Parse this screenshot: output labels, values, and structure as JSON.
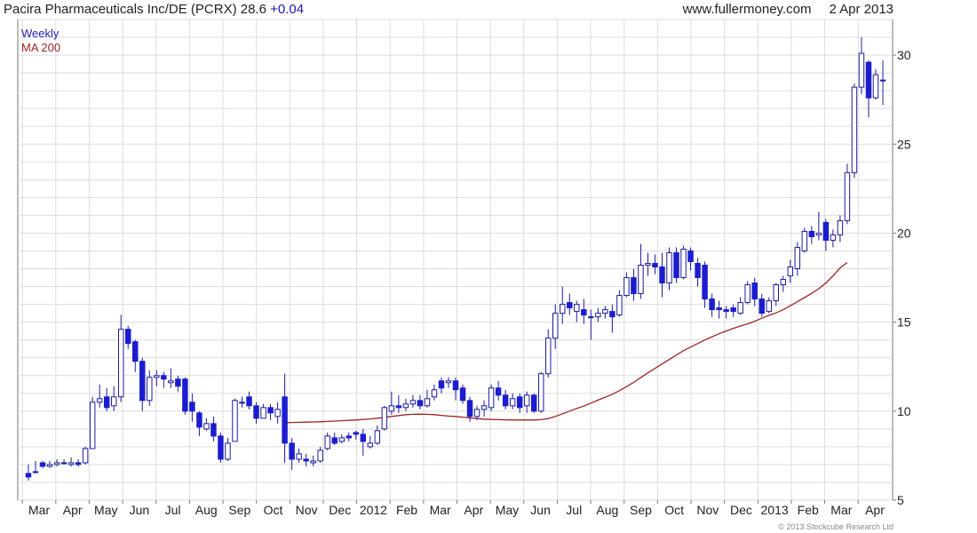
{
  "header": {
    "title": "Pacira Pharmaceuticals Inc/DE (PCRX) 28.6",
    "change": "+0.04",
    "site": "www.fullermoney.com",
    "date": "2 Apr 2013"
  },
  "legend": {
    "weekly": "Weekly",
    "ma": "MA 200"
  },
  "copyright": "© 2013 Stockcube Research Ltd",
  "colors": {
    "up": "#ffffff",
    "down": "#1c1ccf",
    "wick": "#1c1c9c",
    "ma": "#a02424",
    "grid": "#dddddd",
    "frame": "#777777"
  },
  "chart_data": {
    "type": "candlestick",
    "title": "Pacira Pharmaceuticals Inc/DE (PCRX) 28.6 +0.04",
    "xlabel": "",
    "ylabel": "",
    "ylim": [
      5,
      32
    ],
    "y_ticks": [
      5,
      10,
      15,
      20,
      25,
      30
    ],
    "grid": true,
    "legend_position": "top-left",
    "x_labels": [
      "Mar",
      "Apr",
      "May",
      "Jun",
      "Jul",
      "Aug",
      "Sep",
      "Oct",
      "Nov",
      "Dec",
      "2012",
      "Feb",
      "Mar",
      "Apr",
      "May",
      "Jun",
      "Jul",
      "Aug",
      "Sep",
      "Oct",
      "Nov",
      "Dec",
      "2013",
      "Feb",
      "Mar",
      "Apr"
    ],
    "candle_series_name": "Weekly",
    "candles": [
      [
        6.5,
        6.3,
        7.0,
        6.1
      ],
      [
        6.6,
        6.6,
        7.2,
        6.5
      ],
      [
        7.1,
        6.9,
        7.2,
        6.8
      ],
      [
        6.9,
        7.0,
        7.2,
        6.8
      ],
      [
        7.0,
        7.1,
        7.3,
        6.9
      ],
      [
        7.1,
        7.1,
        7.3,
        7.0
      ],
      [
        7.0,
        7.1,
        7.4,
        6.9
      ],
      [
        7.1,
        7.0,
        7.3,
        6.9
      ],
      [
        7.1,
        7.9,
        8.0,
        7.0
      ],
      [
        7.9,
        10.5,
        10.8,
        7.9
      ],
      [
        10.5,
        10.7,
        11.5,
        10.2
      ],
      [
        10.8,
        10.2,
        11.3,
        10.0
      ],
      [
        10.3,
        10.8,
        11.4,
        10.0
      ],
      [
        10.8,
        14.6,
        15.4,
        10.5
      ],
      [
        14.6,
        13.8,
        14.8,
        13.5
      ],
      [
        13.9,
        12.8,
        14.0,
        12.2
      ],
      [
        12.8,
        10.6,
        13.0,
        10.0
      ],
      [
        10.6,
        11.9,
        12.3,
        10.3
      ],
      [
        11.9,
        12.0,
        12.3,
        11.4
      ],
      [
        12.0,
        11.8,
        12.2,
        11.3
      ],
      [
        11.6,
        11.7,
        12.4,
        11.3
      ],
      [
        11.8,
        11.4,
        12.0,
        11.1
      ],
      [
        11.8,
        10.0,
        11.9,
        9.8
      ],
      [
        10.5,
        10.0,
        11.0,
        9.4
      ],
      [
        9.9,
        9.1,
        10.0,
        8.6
      ],
      [
        9.0,
        9.3,
        9.6,
        8.9
      ],
      [
        9.3,
        8.6,
        9.7,
        8.3
      ],
      [
        8.6,
        7.3,
        8.8,
        7.1
      ],
      [
        7.3,
        8.2,
        8.5,
        7.2
      ],
      [
        8.3,
        10.6,
        10.7,
        8.3
      ],
      [
        10.5,
        10.5,
        10.8,
        10.2
      ],
      [
        10.8,
        10.3,
        11.1,
        10.1
      ],
      [
        10.3,
        9.6,
        10.5,
        9.3
      ],
      [
        9.6,
        10.2,
        10.4,
        9.6
      ],
      [
        10.2,
        9.9,
        10.4,
        9.5
      ],
      [
        9.7,
        10.1,
        10.5,
        9.3
      ],
      [
        10.8,
        8.2,
        12.1,
        7.1
      ],
      [
        8.2,
        7.3,
        8.5,
        6.7
      ],
      [
        7.3,
        7.6,
        7.9,
        7.1
      ],
      [
        7.3,
        7.2,
        7.6,
        6.9
      ],
      [
        7.1,
        7.2,
        7.5,
        6.9
      ],
      [
        7.2,
        7.8,
        8.0,
        7.1
      ],
      [
        7.9,
        8.6,
        8.8,
        7.8
      ],
      [
        8.5,
        8.2,
        8.8,
        8.1
      ],
      [
        8.3,
        8.5,
        8.7,
        8.2
      ],
      [
        8.6,
        8.5,
        8.8,
        8.3
      ],
      [
        8.8,
        8.7,
        8.9,
        8.4
      ],
      [
        8.7,
        8.3,
        9.0,
        7.5
      ],
      [
        8.0,
        8.2,
        8.6,
        7.9
      ],
      [
        8.2,
        8.9,
        9.2,
        8.1
      ],
      [
        9.0,
        10.2,
        10.3,
        8.9
      ],
      [
        10.0,
        10.3,
        11.1,
        9.8
      ],
      [
        10.3,
        10.2,
        10.9,
        9.9
      ],
      [
        10.2,
        10.4,
        10.7,
        10.0
      ],
      [
        10.4,
        10.6,
        10.9,
        10.2
      ],
      [
        10.6,
        10.3,
        10.9,
        10.1
      ],
      [
        10.3,
        10.7,
        11.2,
        10.2
      ],
      [
        10.8,
        11.2,
        11.5,
        10.6
      ],
      [
        11.7,
        11.3,
        11.9,
        11.0
      ],
      [
        11.6,
        11.7,
        11.9,
        11.3
      ],
      [
        11.7,
        11.2,
        11.9,
        10.6
      ],
      [
        11.3,
        10.6,
        11.5,
        10.4
      ],
      [
        10.6,
        9.7,
        10.8,
        9.4
      ],
      [
        9.7,
        10.1,
        10.3,
        9.5
      ],
      [
        10.1,
        10.3,
        10.6,
        9.7
      ],
      [
        10.2,
        11.3,
        11.5,
        10.0
      ],
      [
        11.3,
        10.9,
        11.7,
        10.6
      ],
      [
        10.9,
        10.3,
        11.2,
        10.1
      ],
      [
        10.3,
        10.7,
        11.0,
        10.1
      ],
      [
        10.8,
        10.2,
        11.0,
        9.9
      ],
      [
        10.3,
        10.9,
        11.1,
        9.9
      ],
      [
        10.9,
        10.0,
        11.0,
        9.9
      ],
      [
        10.0,
        12.1,
        12.2,
        9.9
      ],
      [
        12.1,
        14.1,
        14.6,
        11.9
      ],
      [
        14.1,
        15.5,
        16.0,
        13.5
      ],
      [
        15.5,
        16.0,
        17.0,
        14.9
      ],
      [
        16.1,
        15.8,
        16.6,
        15.4
      ],
      [
        15.6,
        16.0,
        16.2,
        15.0
      ],
      [
        15.7,
        15.4,
        16.3,
        14.9
      ],
      [
        15.3,
        15.3,
        15.7,
        14.0
      ],
      [
        15.3,
        15.5,
        15.8,
        15.0
      ],
      [
        15.5,
        15.7,
        15.9,
        15.2
      ],
      [
        15.6,
        15.3,
        16.0,
        14.4
      ],
      [
        15.4,
        16.5,
        16.8,
        15.3
      ],
      [
        16.5,
        17.5,
        17.8,
        16.4
      ],
      [
        17.5,
        16.6,
        18.0,
        16.2
      ],
      [
        16.6,
        18.2,
        19.4,
        16.3
      ],
      [
        18.2,
        18.3,
        18.9,
        17.6
      ],
      [
        18.3,
        18.1,
        18.8,
        17.7
      ],
      [
        18.1,
        17.2,
        18.9,
        16.4
      ],
      [
        17.2,
        18.9,
        19.2,
        16.8
      ],
      [
        18.9,
        17.5,
        19.2,
        17.2
      ],
      [
        17.5,
        19.1,
        19.3,
        17.4
      ],
      [
        19.0,
        18.4,
        19.2,
        17.9
      ],
      [
        18.3,
        17.5,
        18.6,
        17.0
      ],
      [
        18.2,
        16.3,
        18.4,
        15.8
      ],
      [
        16.3,
        15.7,
        16.6,
        15.3
      ],
      [
        15.8,
        15.7,
        16.2,
        15.2
      ],
      [
        15.7,
        15.6,
        15.9,
        15.2
      ],
      [
        15.8,
        15.6,
        16.0,
        15.3
      ],
      [
        15.5,
        16.1,
        16.4,
        15.4
      ],
      [
        16.1,
        17.1,
        17.3,
        16.0
      ],
      [
        17.2,
        16.3,
        17.5,
        15.9
      ],
      [
        16.3,
        15.5,
        16.6,
        15.3
      ],
      [
        15.6,
        16.2,
        16.4,
        15.5
      ],
      [
        16.2,
        17.1,
        17.2,
        15.9
      ],
      [
        17.1,
        17.4,
        17.6,
        16.7
      ],
      [
        17.6,
        18.1,
        18.5,
        17.2
      ],
      [
        18.0,
        19.2,
        19.5,
        17.6
      ],
      [
        19.0,
        20.1,
        20.3,
        18.9
      ],
      [
        20.1,
        19.8,
        20.4,
        19.4
      ],
      [
        19.9,
        20.0,
        21.2,
        19.6
      ],
      [
        20.6,
        19.6,
        20.8,
        19.0
      ],
      [
        19.6,
        19.9,
        20.2,
        19.2
      ],
      [
        19.9,
        20.7,
        21.0,
        19.5
      ],
      [
        20.7,
        23.4,
        23.9,
        20.5
      ],
      [
        23.4,
        28.2,
        28.4,
        23.1
      ],
      [
        28.2,
        30.1,
        31.0,
        27.8
      ],
      [
        29.6,
        27.6,
        29.7,
        26.5
      ],
      [
        27.6,
        28.9,
        29.2,
        27.5
      ],
      [
        28.6,
        28.6,
        29.7,
        27.2
      ]
    ],
    "ma_series": {
      "name": "MA 200",
      "start_index": 36,
      "values": [
        9.35,
        9.36,
        9.37,
        9.38,
        9.39,
        9.4,
        9.42,
        9.44,
        9.46,
        9.48,
        9.5,
        9.53,
        9.56,
        9.6,
        9.65,
        9.7,
        9.75,
        9.8,
        9.82,
        9.83,
        9.82,
        9.8,
        9.76,
        9.72,
        9.7,
        9.66,
        9.62,
        9.58,
        9.55,
        9.53,
        9.52,
        9.51,
        9.5,
        9.5,
        9.5,
        9.5,
        9.52,
        9.58,
        9.7,
        9.85,
        10.0,
        10.15,
        10.28,
        10.45,
        10.62,
        10.78,
        10.95,
        11.15,
        11.38,
        11.62,
        11.88,
        12.15,
        12.4,
        12.65,
        12.9,
        13.15,
        13.4,
        13.6,
        13.8,
        14.0,
        14.18,
        14.35,
        14.5,
        14.65,
        14.78,
        14.9,
        15.05,
        15.22,
        15.38,
        15.52,
        15.7,
        15.92,
        16.15,
        16.38,
        16.62,
        16.88,
        17.2,
        17.6,
        18.05,
        18.35
      ]
    }
  }
}
